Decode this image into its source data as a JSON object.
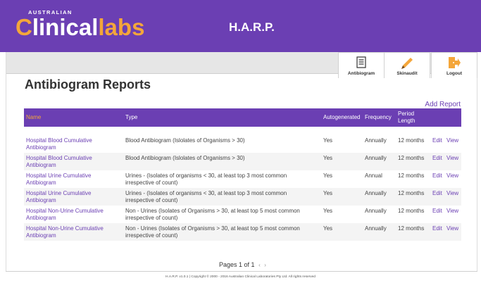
{
  "brand": {
    "small": "AUSTRALIAN",
    "main_c": "C",
    "main_linical": "linical",
    "main_labs": "labs"
  },
  "app_title": "H.A.R.P.",
  "toolbar": {
    "antibiogram": "Antibiogram",
    "skinaudit": "Skinaudit",
    "logout": "Logout"
  },
  "page_title": "Antibiogram Reports",
  "add_report": "Add Report",
  "table": {
    "headers": {
      "name": "Name",
      "type": "Type",
      "autogenerated": "Autogenerated",
      "frequency": "Frequency",
      "period_line1": "Period",
      "period_line2": "Length"
    },
    "rows": [
      {
        "name": "Hospital Blood Cumulative Antibiogram",
        "type": "Blood Antibiogram (Islolates of Organisms > 30)",
        "auto": "Yes",
        "freq": "Annually",
        "period": "12 months",
        "edit": "Edit",
        "view": "View"
      },
      {
        "name": "Hospital Blood Cumulative Antibiogram",
        "type": "Blood Antibiogram (Islolates of Organisms > 30)",
        "auto": "Yes",
        "freq": "Annually",
        "period": "12 months",
        "edit": "Edit",
        "view": "View"
      },
      {
        "name": "Hospital Urine Cumulative Antibiogram",
        "type": "Urines - (Isolates of organisms < 30, at least top 3 most common irrespective of count)",
        "auto": "Yes",
        "freq": "Annual",
        "period": "12 months",
        "edit": "Edit",
        "view": "View"
      },
      {
        "name": "Hospital Urine Cumulative Antibiogram",
        "type": "Urines - (Isolates of organisms < 30, at least top 3 most common irrespective of count)",
        "auto": "Yes",
        "freq": "Annually",
        "period": "12 months",
        "edit": "Edit",
        "view": "View"
      },
      {
        "name": "Hospital Non-Urine Cumulative Antibiogram",
        "type": "Non - Urines (Isolates of Organisms > 30, at least top 5 most common irrespective of count)",
        "auto": "Yes",
        "freq": "Annually",
        "period": "12 months",
        "edit": "Edit",
        "view": "View"
      },
      {
        "name": "Hospital Non-Urine Cumulative Antibiogram",
        "type": "Non - Urines (Isolates of Organisms > 30, at least top 5 most common irrespective of count)",
        "auto": "Yes",
        "freq": "Annually",
        "period": "12 months",
        "edit": "Edit",
        "view": "View"
      }
    ]
  },
  "pager": {
    "text": "Pages 1 of 1",
    "prev": "‹",
    "next": "›"
  },
  "footer": "H.A.R.P. v1.0.1 | Copyright © 2000 - 2016 Australian Clinical Laboratories Pty Ltd. All rights reserved",
  "colors": {
    "brand_purple": "#6b3fb3",
    "brand_orange": "#f4a63a"
  },
  "icons": {
    "antibiogram": "document-icon",
    "skinaudit": "pencil-icon",
    "logout": "door-exit-icon"
  }
}
